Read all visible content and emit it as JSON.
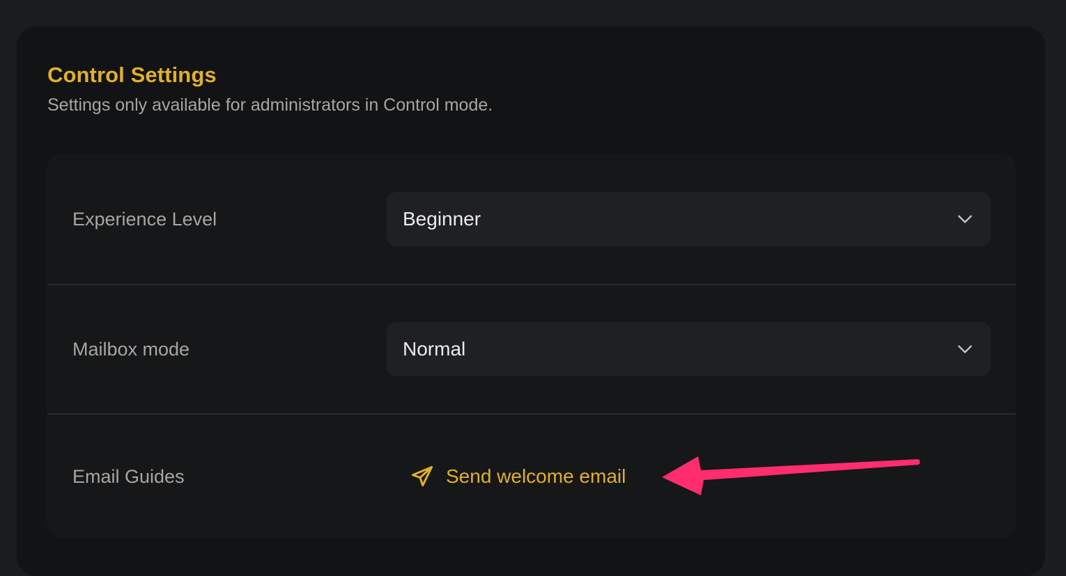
{
  "section": {
    "title": "Control Settings",
    "subtitle": "Settings only available for administrators in Control mode."
  },
  "settings": {
    "experience_level": {
      "label": "Experience Level",
      "value": "Beginner"
    },
    "mailbox_mode": {
      "label": "Mailbox mode",
      "value": "Normal"
    },
    "email_guides": {
      "label": "Email Guides",
      "action_label": "Send welcome email"
    }
  },
  "colors": {
    "accent": "#e1b02b",
    "annotation": "#ff2d6e",
    "background": "#121315"
  },
  "icons": {
    "select_chevron": "chevron-down-icon",
    "send": "paper-plane-icon"
  }
}
